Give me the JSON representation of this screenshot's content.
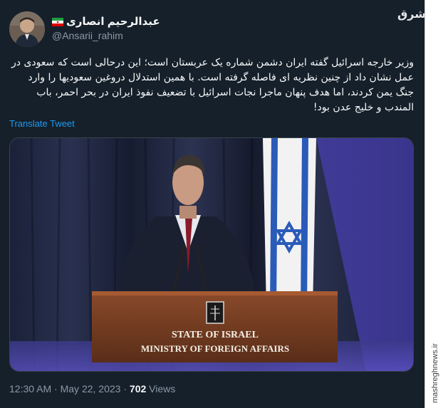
{
  "tweet": {
    "display_name": "عبدالرحیم انصاری",
    "handle": "@Ansarii_rahim",
    "text": "وزیر خارجه اسرائیل گفته ایران دشمن شماره یک عربستان است؛ این درحالی است که سعودی در عمل نشان داد از چنین نظریه ای فاصله گرفته است. با همین استدلال دروغین سعودیها را وارد جنگ یمن کردند، اما هدف پنهان ماجرا نجات اسرائیل با تضعیف نفوذ ایران در بحر احمر، باب المندب و خلیج عدن بود!",
    "translate_label": "Translate Tweet",
    "time": "12:30 AM",
    "separator": "·",
    "date": "May 22, 2023",
    "views_count": "702",
    "views_label": "Views"
  },
  "image": {
    "podium_line1": "STATE OF ISRAEL",
    "podium_line2": "MINISTRY OF FOREIGN AFFAIRS"
  },
  "watermark": {
    "logo": "مشرق",
    "site": "mashreghnews.ir"
  }
}
